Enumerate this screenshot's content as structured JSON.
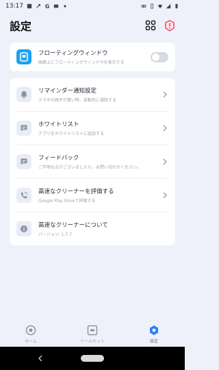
{
  "status_bar": {
    "time": "13:17"
  },
  "header": {
    "title": "設定"
  },
  "floating_window": {
    "title": "フローティングウィンドウ",
    "subtitle": "画面上にフローティングウィンドウを表示する",
    "enabled": false
  },
  "settings_list": [
    {
      "title": "リマインダー通知設定",
      "subtitle": "スマホの調子が悪い時、自動的に通知する",
      "icon": "bell-icon",
      "has_chevron": true
    },
    {
      "title": "ホワイトリスト",
      "subtitle": "アプリをホワイトリストに追加する",
      "icon": "message-icon",
      "has_chevron": true
    },
    {
      "title": "フィードバック",
      "subtitle": "ご不明な点がございましたら、お問い合わせください。",
      "icon": "feedback-icon",
      "has_chevron": true
    },
    {
      "title": "高速なクリーナーを評価する",
      "subtitle": "Google Play Storeで評価する",
      "icon": "phone-rate-icon",
      "has_chevron": true
    },
    {
      "title": "高速なクリーナーについて",
      "subtitle": "バージョン: 1.7.7",
      "icon": "info-icon",
      "has_chevron": false
    }
  ],
  "bottom_nav": [
    {
      "label": "ホーム",
      "icon": "home-icon",
      "active": false
    },
    {
      "label": "ツールキット",
      "icon": "toolkit-icon",
      "active": false
    },
    {
      "label": "設定",
      "icon": "settings-hex-icon",
      "active": true
    }
  ],
  "colors": {
    "background": "#eef1fa",
    "accent_blue": "#1aa3ef",
    "nav_active": "#2f7df6",
    "alert_pink": "#e84b6b"
  }
}
